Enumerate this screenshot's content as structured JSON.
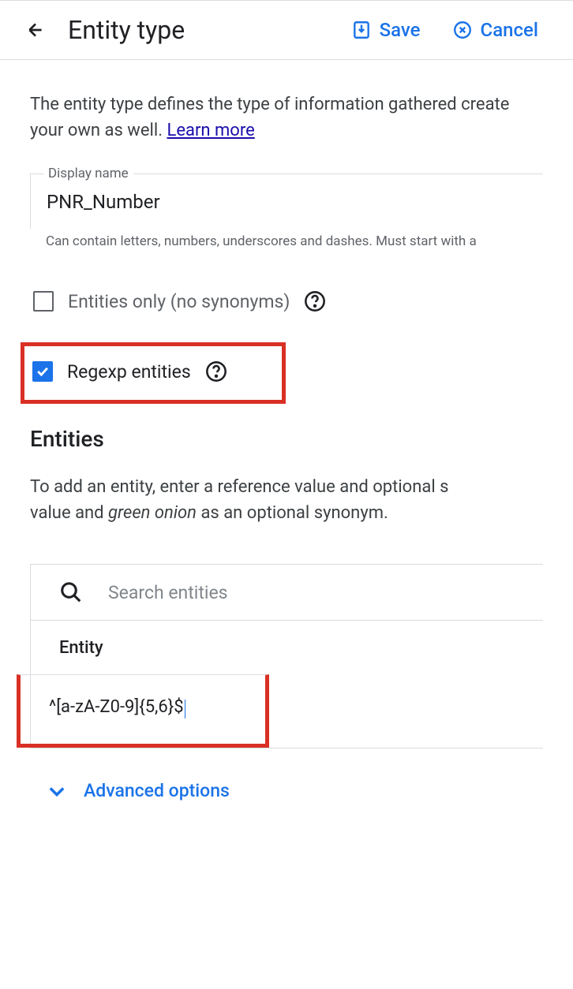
{
  "header": {
    "title": "Entity type",
    "save_label": "Save",
    "cancel_label": "Cancel"
  },
  "description": {
    "text_prefix": "The entity type defines the type of information gathered create your own as well. ",
    "learn_more": "Learn more"
  },
  "display_name": {
    "label": "Display name",
    "value": "PNR_Number",
    "hint": "Can contain letters, numbers, underscores and dashes. Must start with a"
  },
  "checkboxes": {
    "entities_only": {
      "label": "Entities only (no synonyms)",
      "checked": false
    },
    "regexp": {
      "label": "Regexp entities",
      "checked": true
    }
  },
  "entities_section": {
    "title": "Entities",
    "description_prefix": "To add an entity, enter a reference value and optional s",
    "description_middle": "value and ",
    "description_italic": "green onion",
    "description_suffix": " as an optional synonym."
  },
  "search": {
    "placeholder": "Search entities"
  },
  "table": {
    "column_header": "Entity",
    "rows": [
      {
        "value": "^[a-zA-Z0-9]{5,6}$"
      }
    ]
  },
  "advanced": {
    "label": "Advanced options"
  }
}
